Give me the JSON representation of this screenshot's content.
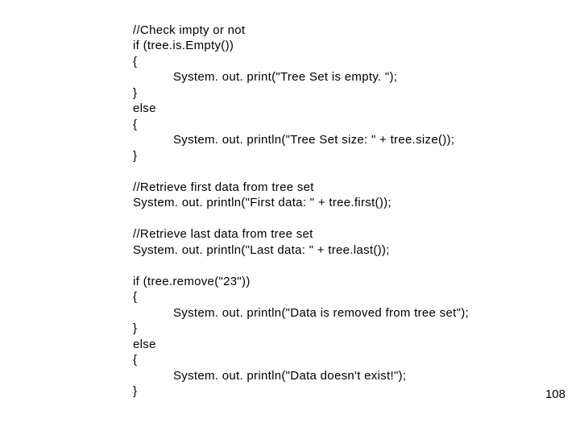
{
  "code": {
    "l01": "//Check impty or not",
    "l02": "if (tree.is.Empty())",
    "l03": "{",
    "l04": "System. out. print(\"Tree Set is empty. \");",
    "l05": "}",
    "l06": "else",
    "l07": "{",
    "l08": "System. out. println(\"Tree Set size: \" + tree.size());",
    "l09": "}",
    "l10": "",
    "l11": "//Retrieve first data from tree set",
    "l12": "System. out. println(\"First data: \" + tree.first());",
    "l13": "",
    "l14": "//Retrieve last data from tree set",
    "l15": "System. out. println(\"Last data: \" + tree.last());",
    "l16": "",
    "l17": "if (tree.remove(\"23\"))",
    "l18": "{",
    "l19": "System. out. println(\"Data is removed from tree set\");",
    "l20": "}",
    "l21": "else",
    "l22": "{",
    "l23": "System. out. println(\"Data doesn't exist!\");",
    "l24": "}"
  },
  "page_number": "108"
}
